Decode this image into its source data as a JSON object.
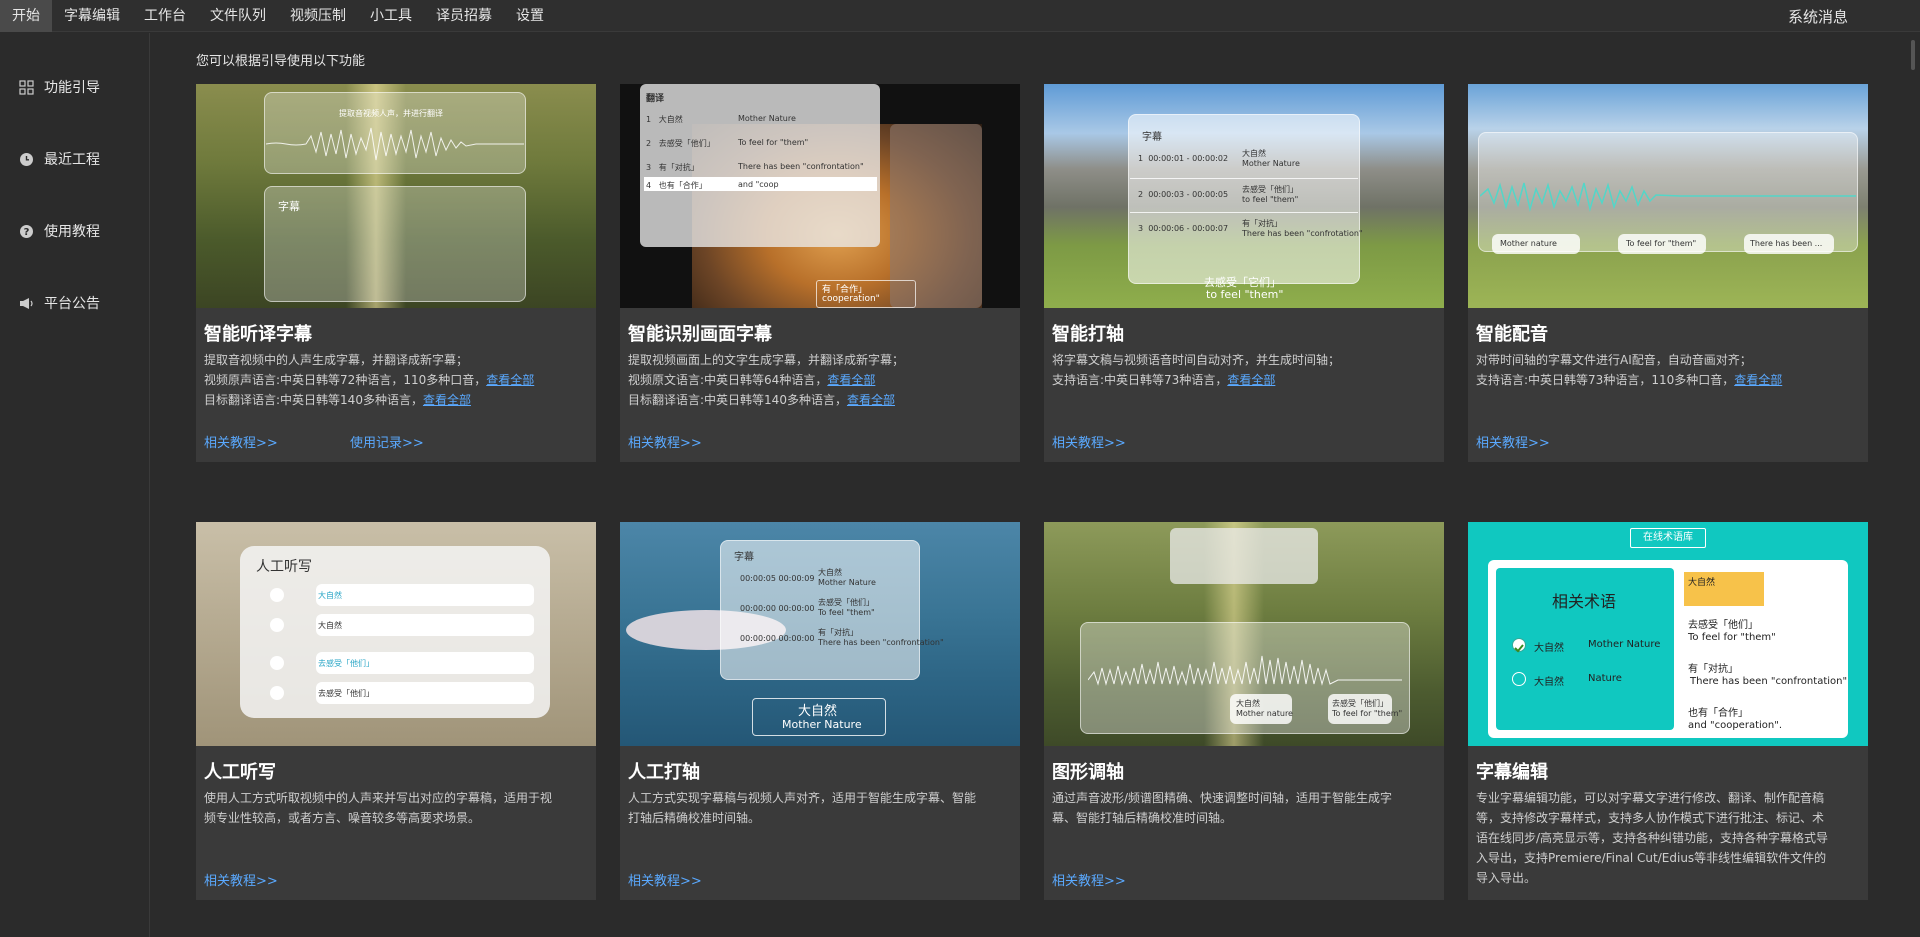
{
  "menu": [
    "开始",
    "字幕编辑",
    "工作台",
    "文件队列",
    "视频压制",
    "小工具",
    "译员招募",
    "设置"
  ],
  "system_messages": "系统消息",
  "sidebar": [
    {
      "label": "功能引导",
      "icon": "grid-icon"
    },
    {
      "label": "最近工程",
      "icon": "clock-icon"
    },
    {
      "label": "使用教程",
      "icon": "help-icon"
    },
    {
      "label": "平台公告",
      "icon": "megaphone-icon"
    }
  ],
  "intro": "您可以根据引导使用以下功能",
  "see_all": "查看全部",
  "cards": [
    {
      "title": "智能听译字幕",
      "line1": "提取音视频中的人声生成字幕，并翻译成新字幕；",
      "line2": "视频原声语言:中英日韩等72种语言，110多种口音，",
      "line3": "目标翻译语言:中英日韩等140多种语言，",
      "link1": "相关教程>>",
      "link2": "使用记录>>",
      "overlay": {
        "top_text": "提取音视频人声，并进行翻译",
        "box_label": "字幕"
      }
    },
    {
      "title": "智能识别画面字幕",
      "line1": "提取视频画面上的文字生成字幕，并翻译成新字幕；",
      "line2": "视频原文语言:中英日韩等64种语言，",
      "line3": "目标翻译语言:中英日韩等140多种语言，",
      "link1": "相关教程>>",
      "overlay": {
        "header": "翻译",
        "rows": [
          {
            "n": "1",
            "cn": "大自然",
            "en": "Mother Nature"
          },
          {
            "n": "2",
            "cn": "去感受「他们」",
            "en": "To feel for \"them\""
          },
          {
            "n": "3",
            "cn": "有「对抗」",
            "en": "There has been \"confrontation\""
          },
          {
            "n": "4",
            "cn": "也有「合作」",
            "en": "and \"coop"
          }
        ],
        "bottom_cn": "有「合作」",
        "bottom_en": "cooperation\""
      }
    },
    {
      "title": "智能打轴",
      "line1": "将字幕文稿与视频语音时间自动对齐，并生成时间轴；",
      "line2": "支持语言:中英日韩等73种语言，",
      "link1": "相关教程>>",
      "overlay": {
        "header": "字幕",
        "rows": [
          {
            "n": "1",
            "t1": "00:00:01",
            "t2": "00:00:02",
            "cn": "大自然",
            "en": "Mother Nature"
          },
          {
            "n": "2",
            "t1": "00:00:03",
            "t2": "00:00:05",
            "cn": "去感受「他们」",
            "en": "to feel \"them\""
          },
          {
            "n": "3",
            "t1": "00:00:06",
            "t2": "00:00:07",
            "cn": "有「对抗」",
            "en": "There has been \"confrotation\""
          }
        ],
        "sub_cn": "去感受「它们」",
        "sub_en": "to feel \"them\""
      }
    },
    {
      "title": "智能配音",
      "line1": "对带时间轴的字幕文件进行AI配音，自动音画对齐；",
      "line2": "支持语言:中英日韩等73种语言，110多种口音，",
      "link1": "相关教程>>",
      "overlay": {
        "chips": [
          "Mother nature",
          "To feel for \"them\"",
          "There has been ..."
        ]
      }
    },
    {
      "title": "人工听写",
      "line1": "使用人工方式听取视频中的人声来并写出对应的字幕稿，适用于视",
      "line2": "频专业性较高，或者方言、噪音较多等高要求场景。",
      "link1": "相关教程>>",
      "overlay": {
        "header": "人工听写",
        "items": [
          "大自然",
          "大自然",
          "去感受「他们」",
          "去感受「他们」"
        ]
      }
    },
    {
      "title": "人工打轴",
      "line1": "人工方式实现字幕稿与视频人声对齐，适用于智能生成字幕、智能",
      "line2": "打轴后精确校准时间轴。",
      "link1": "相关教程>>",
      "overlay": {
        "header": "字幕",
        "rows": [
          {
            "t": "00:00:05 00:00:09",
            "cn": "大自然",
            "en": "Mother Nature"
          },
          {
            "t": "00:00:00 00:00:00",
            "cn": "去感受「他们」",
            "en": "To feel \"them\""
          },
          {
            "t": "00:00:00 00:00:00",
            "cn": "有「对抗」",
            "en": "There has been \"confrontation\""
          }
        ],
        "sub_cn": "大自然",
        "sub_en": "Mother Nature"
      }
    },
    {
      "title": "图形调轴",
      "line1": "通过声音波形/频谱图精确、快速调整时间轴，适用于智能生成字",
      "line2": "幕、智能打轴后精确校准时间轴。",
      "link1": "相关教程>>",
      "overlay": {
        "chip1_cn": "大自然",
        "chip1_en": "Mother nature",
        "chip2_cn": "去感受「他们」",
        "chip2_en": "To feel for \"them\""
      }
    },
    {
      "title": "字幕编辑",
      "line1": "专业字幕编辑功能，可以对字幕文字进行修改、翻译、制作配音稿",
      "line2": "等，支持修改字幕样式，支持多人协作模式下进行批注、标记、术",
      "line3": "语在线同步/高亮显示等，支持各种纠错功能，支持各种字幕格式导",
      "line4": "入导出，支持Premiere/Final Cut/Edius等非线性编辑软件文件的",
      "line5": "导入导出。",
      "overlay": {
        "button": "在线术语库",
        "panel_title": "相关术语",
        "opt1_cn": "大自然",
        "opt1_en": "Mother Nature",
        "opt2_cn": "大自然",
        "opt2_en": "Nature",
        "r_title": "大自然",
        "r1_cn": "去感受「他们」",
        "r1_en": "To feel for \"them\"",
        "r2_cn": "有「对抗」",
        "r2_en": "There has been \"confrontation\"",
        "r3_cn": "也有「合作」",
        "r3_en": "and \"cooperation\"."
      }
    }
  ],
  "colors": {
    "accent_link": "#5aa9ff",
    "teal": "#10c8c0",
    "bg": "#2b2b2b",
    "card": "#3a3a3a"
  }
}
